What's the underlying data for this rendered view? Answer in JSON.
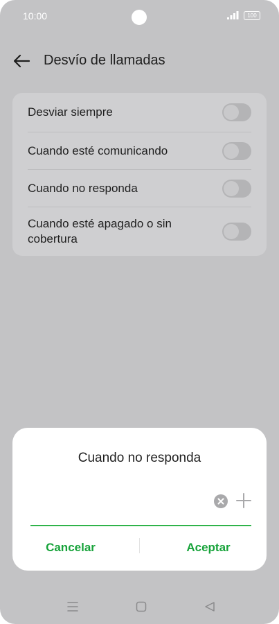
{
  "status_bar": {
    "time": "10:00",
    "battery": "100"
  },
  "app_bar": {
    "title": "Desvío de llamadas",
    "back_icon": "arrow-left-icon"
  },
  "options": [
    {
      "label": "Desviar siempre",
      "enabled": false
    },
    {
      "label": "Cuando esté comunicando",
      "enabled": false
    },
    {
      "label": "Cuando no responda",
      "enabled": false
    },
    {
      "label": "Cuando esté apagado o sin cobertura",
      "enabled": false
    }
  ],
  "dialog": {
    "title": "Cuando no responda",
    "input_value": "",
    "clear_icon": "clear-circle-icon",
    "add_icon": "plus-icon",
    "cancel_label": "Cancelar",
    "accept_label": "Aceptar"
  },
  "colors": {
    "accent": "#17a33a",
    "underline": "#2fb34a",
    "overlay": "#c3c3c5"
  },
  "nav_bar": {
    "icons": [
      "menu-icon",
      "home-square-icon",
      "back-triangle-icon"
    ]
  }
}
